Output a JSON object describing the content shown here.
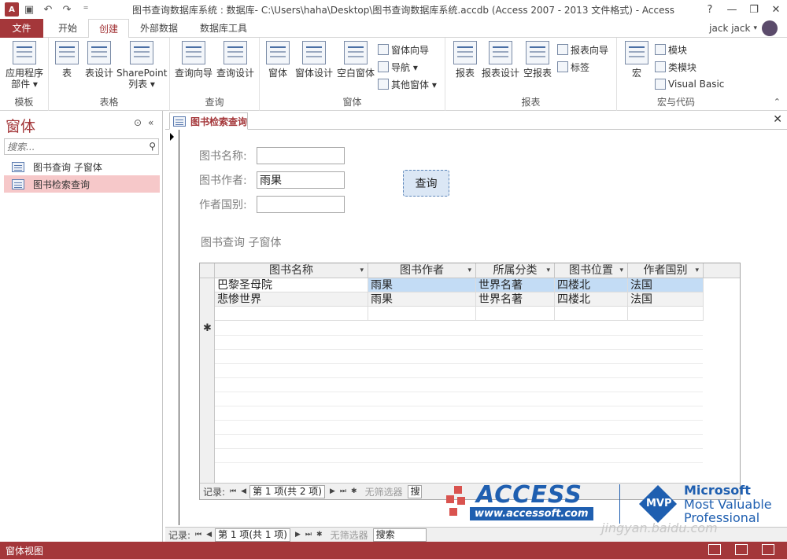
{
  "window": {
    "title": "图书查询数据库系统 : 数据库- C:\\Users\\haha\\Desktop\\图书查询数据库系统.accdb (Access 2007 - 2013 文件格式) - Access",
    "help": "?",
    "user": "jack jack"
  },
  "ribbon_tabs": [
    "文件",
    "开始",
    "创建",
    "外部数据",
    "数据库工具"
  ],
  "ribbon": {
    "groups": [
      "模板",
      "表格",
      "查询",
      "窗体",
      "报表",
      "宏与代码"
    ],
    "templates": {
      "app_parts": "应用程序",
      "app_parts2": "部件 ▾"
    },
    "tables": {
      "table": "表",
      "table_design": "表设计",
      "sharepoint": "SharePoint",
      "sharepoint2": "列表 ▾"
    },
    "queries": {
      "wizard": "查询向导",
      "design": "查询设计"
    },
    "forms": {
      "form": "窗体",
      "form_design": "窗体设计",
      "blank_form": "空白窗体",
      "form_wizard": "窗体向导",
      "navigation": "导航 ▾",
      "more_forms": "其他窗体 ▾"
    },
    "reports": {
      "report": "报表",
      "report_design": "报表设计",
      "blank_report": "空报表",
      "report_wizard": "报表向导",
      "labels": "标签"
    },
    "macros": {
      "macro": "宏",
      "module": "模块",
      "class_module": "类模块",
      "vba": "Visual Basic"
    }
  },
  "nav_pane": {
    "title": "窗体",
    "search_placeholder": "搜索...",
    "items": [
      {
        "label": "图书查询 子窗体",
        "selected": false
      },
      {
        "label": "图书检索查询",
        "selected": true
      }
    ]
  },
  "document": {
    "tab_label": "图书检索查询",
    "fields": [
      {
        "label": "图书名称:",
        "value": ""
      },
      {
        "label": "图书作者:",
        "value": "雨果"
      },
      {
        "label": "作者国别:",
        "value": ""
      }
    ],
    "query_button": "查询",
    "subform_label": "图书查询 子窗体",
    "columns": [
      "图书名称",
      "图书作者",
      "所属分类",
      "图书位置",
      "作者国别"
    ],
    "rows": [
      [
        "巴黎圣母院",
        "雨果",
        "世界名著",
        "四楼北",
        "法国"
      ],
      [
        "悲惨世界",
        "雨果",
        "世界名著",
        "四楼北",
        "法国"
      ]
    ],
    "new_record_marker": "✱",
    "subform_nav": {
      "label": "记录:",
      "position": "第 1 项(共 2 项)",
      "filter": "无筛选器",
      "search": "搜"
    },
    "main_nav": {
      "label": "记录:",
      "position": "第 1 项(共 1 项)",
      "filter": "无筛选器",
      "search": "搜索"
    }
  },
  "watermark": {
    "brand": "ACCESS",
    "url": "www.accessoft.com",
    "mvp": "MVP",
    "ms": "Microsoft",
    "mvp_line1": "Most Valuable",
    "mvp_line2": "Professional",
    "baidu": "jingyan.baidu.com"
  },
  "statusbar": {
    "text": "窗体视图"
  },
  "colors": {
    "accent": "#a4373a",
    "selection": "#c3dcf5",
    "nav_selected": "#f6c8c9"
  }
}
